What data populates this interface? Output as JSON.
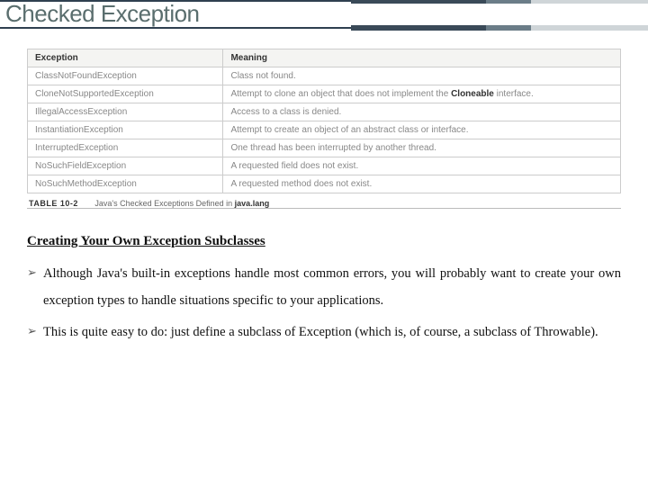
{
  "title": "Checked Exception",
  "table": {
    "headers": [
      "Exception",
      "Meaning"
    ],
    "rows": [
      {
        "name": "ClassNotFoundException",
        "meaning_pre": "Class not found.",
        "bold": "",
        "meaning_post": ""
      },
      {
        "name": "CloneNotSupportedException",
        "meaning_pre": "Attempt to clone an object that does not implement the ",
        "bold": "Cloneable",
        "meaning_post": " interface."
      },
      {
        "name": "IllegalAccessException",
        "meaning_pre": "Access to a class is denied.",
        "bold": "",
        "meaning_post": ""
      },
      {
        "name": "InstantiationException",
        "meaning_pre": "Attempt to create an object of an abstract class or interface.",
        "bold": "",
        "meaning_post": ""
      },
      {
        "name": "InterruptedException",
        "meaning_pre": "One thread has been interrupted by another thread.",
        "bold": "",
        "meaning_post": ""
      },
      {
        "name": "NoSuchFieldException",
        "meaning_pre": "A requested field does not exist.",
        "bold": "",
        "meaning_post": ""
      },
      {
        "name": "NoSuchMethodException",
        "meaning_pre": "A requested method does not exist.",
        "bold": "",
        "meaning_post": ""
      }
    ]
  },
  "caption": {
    "label": "TABLE 10-2",
    "text": "Java's Checked Exceptions Defined in ",
    "pkg": "java.lang"
  },
  "section_heading": "Creating Your Own Exception Subclasses",
  "bullets": [
    "Although Java's built-in exceptions handle most common errors, you will probably want to create your own exception types to handle situations specific to your applications.",
    "This is quite easy to do: just define a subclass of Exception (which is, of course, a subclass of Throwable)."
  ]
}
